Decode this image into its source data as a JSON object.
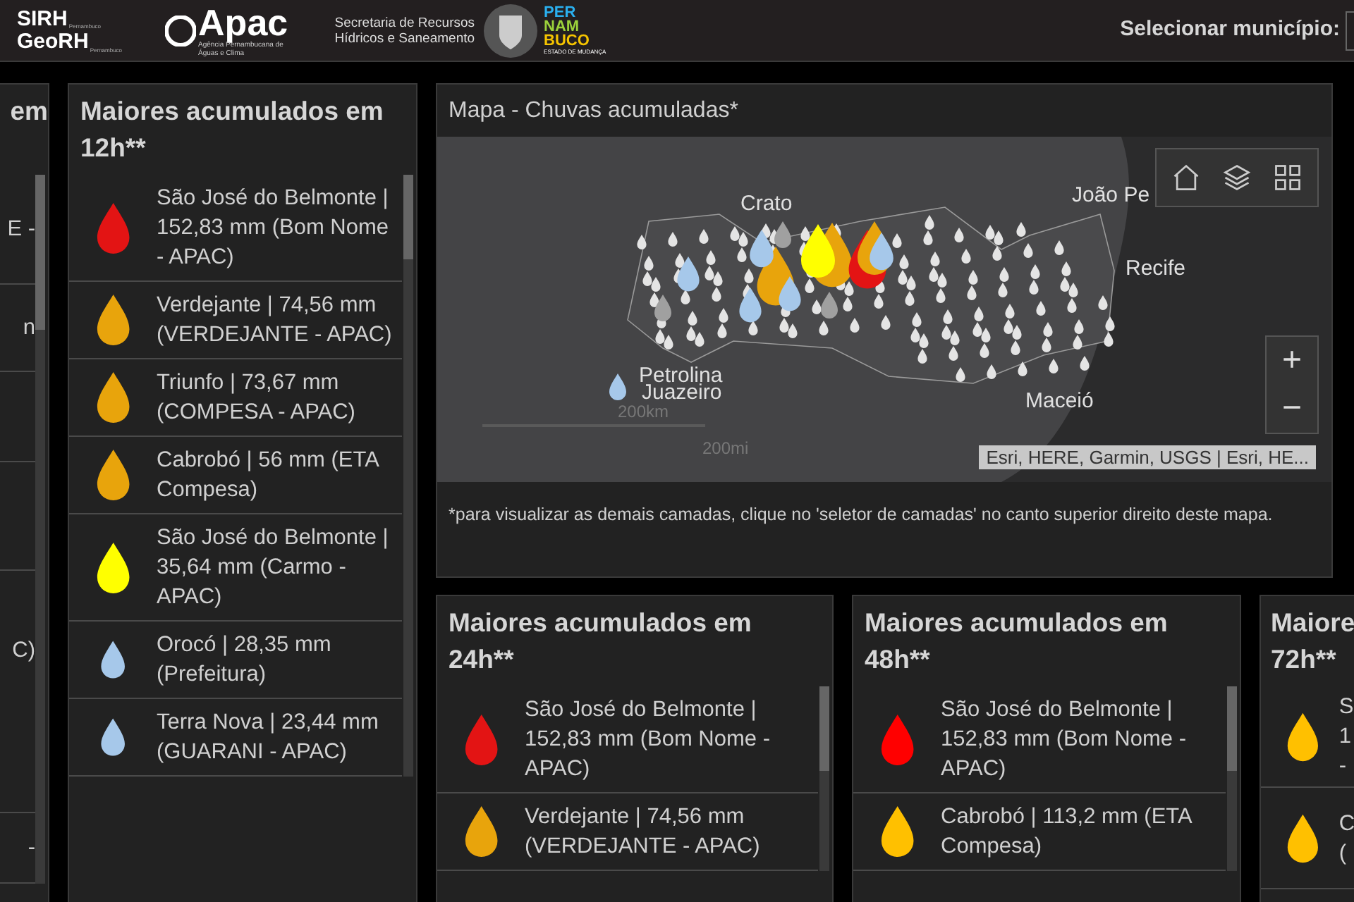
{
  "header": {
    "sirh": "SIRH",
    "sirh_sub": "Pernambuco",
    "georh": "GeoRH",
    "georh_sub": "Pernambuco",
    "apac": "Apac",
    "apac_sub": "Agência Pernambucana de Águas e Clima",
    "secretaria": "Secretaria de Recursos Hídricos e Saneamento",
    "pe_lines": [
      "PER",
      "NAM",
      "BUCO"
    ],
    "pe_sub": "ESTADO DE MUDANÇA",
    "select_label": "Selecionar município:"
  },
  "left_panel": {
    "title": "em",
    "items": [
      {
        "lines": [
          "E -"
        ]
      },
      {
        "lines": [
          "n"
        ]
      },
      {
        "lines": [
          "C)"
        ]
      },
      {
        "lines": [
          "-"
        ]
      }
    ]
  },
  "panel_12h": {
    "title": "Maiores acumulados em 12h**",
    "items": [
      {
        "text": "São José do Belmonte | 152,83 mm  (Bom Nome - APAC)",
        "color": "#e31414"
      },
      {
        "text": "Verdejante | 74,56 mm  (VERDEJANTE - APAC)",
        "color": "#e8a40c"
      },
      {
        "text": "Triunfo | 73,67 mm (COMPESA - APAC)",
        "color": "#e8a40c"
      },
      {
        "text": "Cabrobó | 56 mm (ETA Compesa)",
        "color": "#e8a40c"
      },
      {
        "text": "São José do Belmonte | 35,64 mm  (Carmo - APAC)",
        "color": "#ffff00"
      },
      {
        "text": "Orocó | 28,35 mm (Prefeitura)",
        "color": "#a6c8ea"
      },
      {
        "text": "Terra Nova | 23,44 mm  (GUARANI - APAC)",
        "color": "#a6c8ea"
      }
    ]
  },
  "map": {
    "title": "Mapa - Chuvas acumuladas*",
    "labels": [
      "Crato",
      "João Pe",
      "Recife",
      "Petrolina",
      "Juazeiro",
      "Maceió"
    ],
    "scale_km": "200km",
    "scale_mi": "200mi",
    "attribution": "Esri, HERE, Garmin, USGS | Esri, HE...",
    "zoom_in": "+",
    "zoom_out": "−",
    "note": "*para visualizar as demais camadas, clique no 'seletor de camadas' no canto superior direito deste mapa."
  },
  "panel_24h": {
    "title": "Maiores acumulados em 24h**",
    "items": [
      {
        "text": "São José do Belmonte | 152,83 mm  (Bom Nome - APAC)",
        "color": "#e31414"
      },
      {
        "text": "Verdejante | 74,56 mm (VERDEJANTE - APAC)",
        "color": "#e8a40c"
      }
    ]
  },
  "panel_48h": {
    "title": "Maiores acumulados em 48h**",
    "items": [
      {
        "text": "São José do Belmonte | 152,83 mm  (Bom Nome - APAC)",
        "color": "#ff0000"
      },
      {
        "text": "Cabrobó | 113,2 mm (ETA Compesa)",
        "color": "#ffc000"
      }
    ]
  },
  "panel_72h": {
    "title_lines": [
      "Maiore",
      "72h**"
    ],
    "items": [
      {
        "lines": [
          "S",
          "1",
          "-"
        ],
        "color": "#ffc000"
      },
      {
        "lines": [
          "C",
          "("
        ],
        "color": "#ffc000"
      }
    ]
  }
}
